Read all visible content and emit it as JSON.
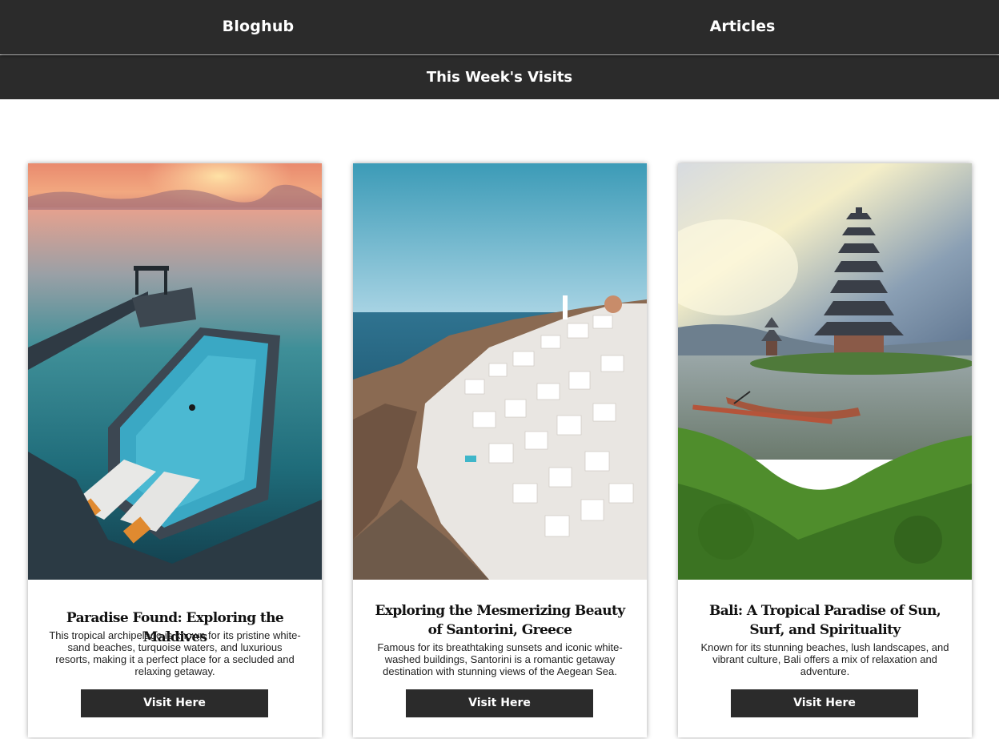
{
  "header": {
    "brand": "Bloghub",
    "nav_articles": "Articles"
  },
  "section": {
    "title": "This Week's Visits"
  },
  "cards": [
    {
      "title": "Paradise Found: Exploring the Maldives",
      "description": "This tropical archipelago is known for its pristine white-sand beaches, turquoise waters, and luxurious resorts, making it a perfect place for a secluded and relaxing getaway.",
      "button": "Visit Here",
      "image": "maldives-overwater-pool-photo"
    },
    {
      "title": "Exploring the Mesmerizing Beauty of Santorini, Greece",
      "description": "Famous for its breathtaking sunsets and iconic white-washed buildings, Santorini is a romantic getaway destination with stunning views of the Aegean Sea.",
      "button": "Visit Here",
      "image": "santorini-white-village-photo"
    },
    {
      "title": "Bali: A Tropical Paradise of Sun, Surf, and Spirituality",
      "description": "Known for its stunning beaches, lush landscapes, and vibrant culture, Bali offers a mix of relaxation and adventure.",
      "button": "Visit Here",
      "image": "bali-water-temple-photo"
    }
  ],
  "colors": {
    "bar": "#2b2b2b",
    "text_light": "#ffffff"
  }
}
